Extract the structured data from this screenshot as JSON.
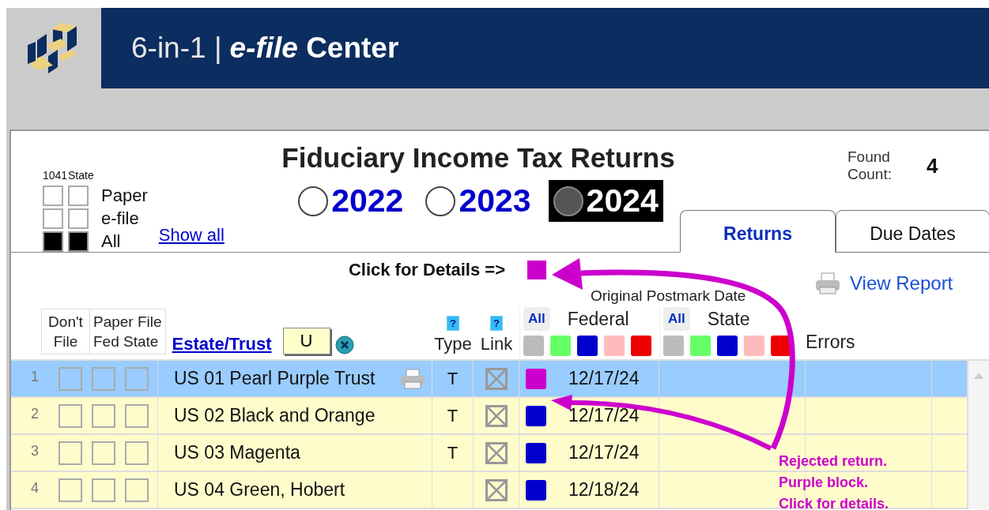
{
  "header": {
    "title_plain": "6-in-1 |",
    "title_bold": "*e-file* Center"
  },
  "filters": {
    "headers": [
      "1041",
      "State"
    ],
    "rows": [
      {
        "label": "Paper",
        "form_1041": false,
        "state": false
      },
      {
        "label": "e-file",
        "form_1041": false,
        "state": false
      },
      {
        "label": "All",
        "form_1041": true,
        "state": true
      }
    ],
    "show_all": "Show all"
  },
  "title": "Fiduciary Income Tax Returns",
  "years": [
    {
      "label": "2022",
      "selected": false
    },
    {
      "label": "2023",
      "selected": false
    },
    {
      "label": "2024",
      "selected": true
    }
  ],
  "found": {
    "label": "Found Count:",
    "value": "4"
  },
  "tabs": [
    {
      "label": "Returns",
      "selected": true
    },
    {
      "label": "Due Dates",
      "selected": false
    }
  ],
  "details": {
    "label": "Click for Details =>"
  },
  "view_report": "View Report",
  "postmark_label": "Original Postmark Date",
  "columns": {
    "dont_file": "Don't File",
    "paper_file": "Paper File",
    "paper_sub": "Fed State",
    "estate": "Estate/Trust",
    "estate_filter": "U",
    "type": {
      "help": "?",
      "label": "Type"
    },
    "link": {
      "help": "?",
      "label": "Link"
    },
    "federal": {
      "all": "All",
      "label": "Federal",
      "swatches": [
        {
          "color": "#bbbbbb"
        },
        {
          "color": "#66ff66"
        },
        {
          "color": "#0000cc"
        },
        {
          "color": "#ffbbbb"
        },
        {
          "color": "#ee0000"
        }
      ]
    },
    "state": {
      "all": "All",
      "label": "State",
      "swatches": [
        {
          "color": "#bbbbbb"
        },
        {
          "color": "#66ff66"
        },
        {
          "color": "#0000cc"
        },
        {
          "color": "#ffbbbb"
        },
        {
          "color": "#ee0000"
        }
      ]
    },
    "errors": "Errors"
  },
  "rows": [
    {
      "number": "1",
      "dont_file": false,
      "paper_fed": false,
      "paper_state": false,
      "name": "US 01 Pearl Purple Trust",
      "print_icon": true,
      "type": "T",
      "linked": true,
      "federal": {
        "color": "#cc00cc",
        "date": "12/17/24"
      },
      "selected": true
    },
    {
      "number": "2",
      "dont_file": false,
      "paper_fed": false,
      "paper_state": false,
      "name": "US 02 Black and Orange",
      "print_icon": false,
      "type": "T",
      "linked": true,
      "federal": {
        "color": "#0000cc",
        "date": "12/17/24"
      },
      "selected": false
    },
    {
      "number": "3",
      "dont_file": false,
      "paper_fed": false,
      "paper_state": false,
      "name": "US 03 Magenta",
      "print_icon": false,
      "type": "T",
      "linked": true,
      "federal": {
        "color": "#0000cc",
        "date": "12/17/24"
      },
      "selected": false
    },
    {
      "number": "4",
      "dont_file": false,
      "paper_fed": false,
      "paper_state": false,
      "name": "US 04 Green, Hobert",
      "print_icon": false,
      "linked": true,
      "federal": {
        "color": "#0000cc",
        "date": "12/18/24"
      },
      "selected": false
    }
  ],
  "annotation": {
    "lines": [
      "Rejected return.",
      "Purple block.",
      "Click for details."
    ]
  }
}
